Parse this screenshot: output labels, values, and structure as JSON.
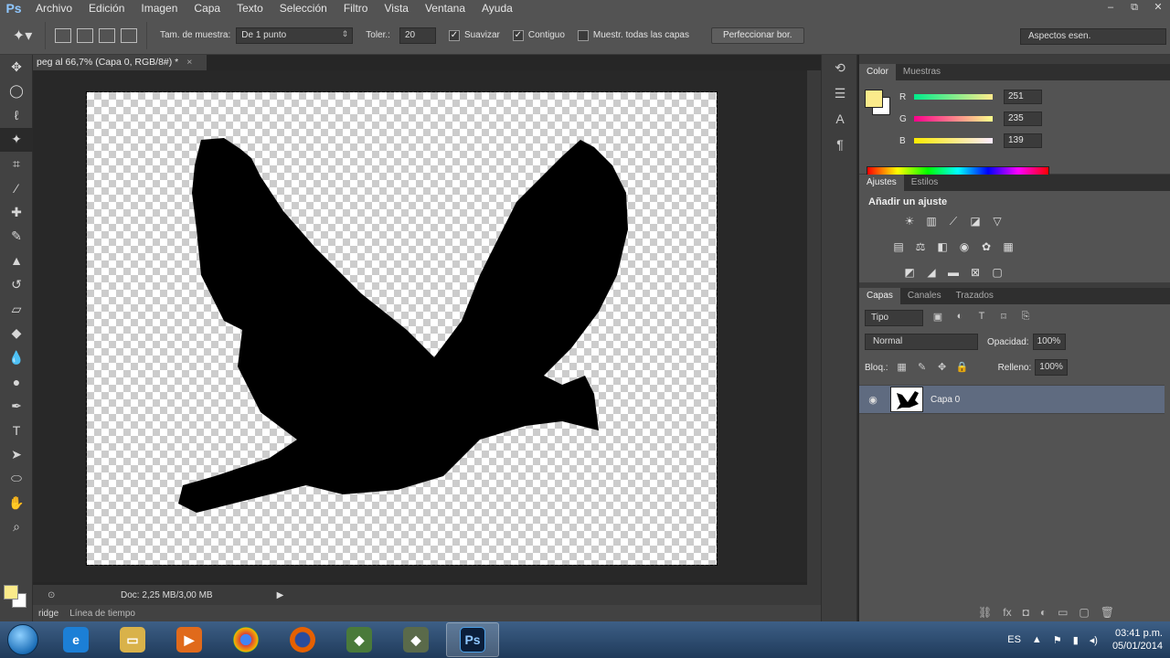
{
  "app": {
    "logo": "Ps",
    "menu": [
      "Archivo",
      "Edición",
      "Imagen",
      "Capa",
      "Texto",
      "Selección",
      "Filtro",
      "Vista",
      "Ventana",
      "Ayuda"
    ],
    "window_controls": [
      "–",
      "⧉",
      "✕"
    ]
  },
  "options": {
    "sample_label": "Tam. de muestra:",
    "sample_value": "De 1 punto",
    "tolerance_label": "Toler.:",
    "tolerance_value": "20",
    "antialias_label": "Suavizar",
    "contiguous_label": "Contiguo",
    "sample_all_label": "Muestr. todas las capas",
    "refine_label": "Perfeccionar bor.",
    "workspace": "Aspectos esen."
  },
  "document": {
    "tab_title": "peg al 66,7% (Capa 0, RGB/8#) *",
    "doc_info": "Doc: 2,25 MB/3,00 MB"
  },
  "bottom_tabs": [
    "ridge",
    "Línea de tiempo"
  ],
  "color_panel": {
    "tabs": [
      "Color",
      "Muestras"
    ],
    "r_label": "R",
    "r_value": "251",
    "g_label": "G",
    "g_value": "235",
    "b_label": "B",
    "b_value": "139",
    "foreground": "#fbeb8b"
  },
  "adjustments_panel": {
    "tabs": [
      "Ajustes",
      "Estilos"
    ],
    "title": "Añadir un ajuste"
  },
  "layers_panel": {
    "tabs": [
      "Capas",
      "Canales",
      "Trazados"
    ],
    "kind": "Tipo",
    "blend_mode": "Normal",
    "opacity_label": "Opacidad:",
    "opacity_value": "100%",
    "lock_label": "Bloq.:",
    "fill_label": "Relleno:",
    "fill_value": "100%",
    "layers": [
      {
        "name": "Capa 0"
      }
    ]
  },
  "taskbar": {
    "language": "ES",
    "time": "03:41 p.m.",
    "date": "05/01/2014"
  }
}
